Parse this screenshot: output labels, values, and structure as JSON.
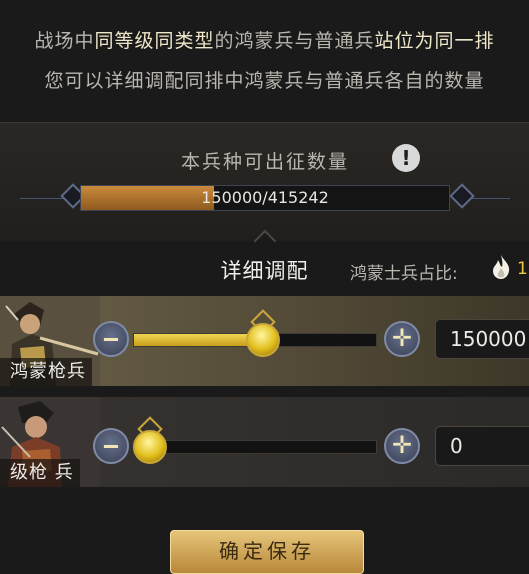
{
  "info": {
    "line1_a": "战场中",
    "line1_b": "同等级同类型",
    "line1_c": "的鸿蒙兵与普通兵",
    "line1_d": "站位为同一排",
    "line2": "您可以详细调配同排中鸿蒙兵与普通兵各自的数量"
  },
  "quota": {
    "label": "本兵种可出征数量",
    "current": 150000,
    "max": 415242,
    "text": "150000/415242",
    "info_icon_glyph": "!"
  },
  "detail": {
    "title": "详细调配",
    "ratio_label": "鸿蒙士兵占比:",
    "ratio_value": "1"
  },
  "rows": [
    {
      "name": "鸿蒙枪兵",
      "value": "150000",
      "fraction": 0.54,
      "minus_glyph": "‒",
      "plus_glyph": "✛"
    },
    {
      "name": "级枪 兵",
      "value": "0",
      "fraction": 0.0,
      "minus_glyph": "‒",
      "plus_glyph": "✛"
    }
  ],
  "confirm_label": "确定保存",
  "colors": {
    "accent_gold": "#f0c73a",
    "bar_orange": "#c98a3c",
    "highlight_text": "#efe7c9"
  }
}
